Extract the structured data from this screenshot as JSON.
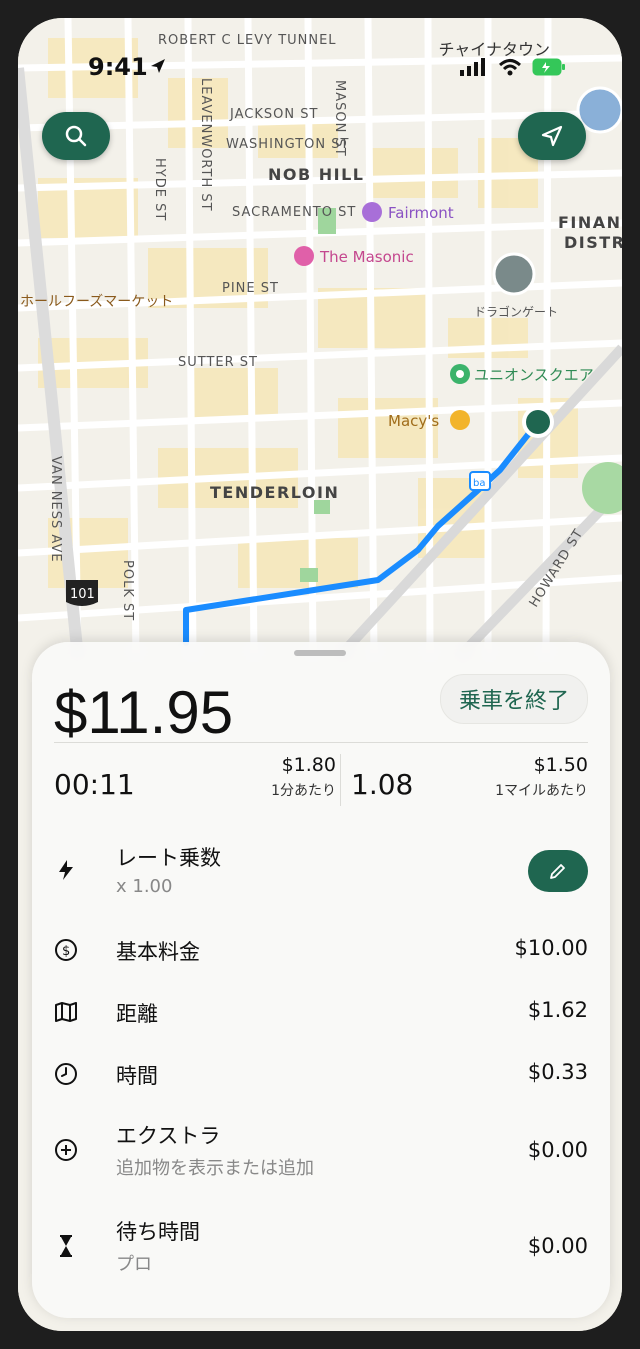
{
  "status_bar": {
    "time": "9:41",
    "carrier_label": "チャイナタウン"
  },
  "map": {
    "labels": {
      "tunnel": "ROBERT C LEVY TUNNEL",
      "jackson": "JACKSON ST",
      "washington": "WASHINGTON ST",
      "nob_hill": "NOB HILL",
      "sacramento": "SACRAMENTO ST",
      "pine": "PINE ST",
      "sutter": "SUTTER ST",
      "tenderloin": "TENDERLOIN",
      "van_ness": "VAN NESS AVE",
      "polk": "POLK ST",
      "hyde": "HYDE ST",
      "leavenworth": "LEAVENWORTH ST",
      "mason": "MASON ST",
      "howard": "HOWARD ST",
      "financial": "FINANCE",
      "district": "DISTRIC",
      "hwy": "101"
    },
    "pois": {
      "fairmont": "Fairmont",
      "masonic": "The Masonic",
      "whole_foods": "ホールフーズマーケット",
      "dragon_gate": "ドラゴンゲート",
      "union_square": "ユニオンスクエア",
      "macys": "Macy's"
    }
  },
  "sheet": {
    "fare": "$11.95",
    "end_ride": "乗車を終了",
    "elapsed": "00:11",
    "per_minute_value": "$1.80",
    "per_minute_label": "1分あたり",
    "distance": "1.08",
    "per_mile_value": "$1.50",
    "per_mile_label": "1マイルあたり",
    "multiplier_label": "レート乗数",
    "multiplier_value": "x 1.00",
    "rows": [
      {
        "label": "基本料金",
        "amount": "$10.00"
      },
      {
        "label": "距離",
        "amount": "$1.62"
      },
      {
        "label": "時間",
        "amount": "$0.33"
      },
      {
        "label": "エクストラ",
        "sub": "追加物を表示または追加",
        "amount": "$0.00"
      },
      {
        "label": "待ち時間",
        "sub": "プロ",
        "amount": "$0.00"
      }
    ]
  },
  "colors": {
    "accent": "#1f6650",
    "route": "#1a8cff"
  }
}
